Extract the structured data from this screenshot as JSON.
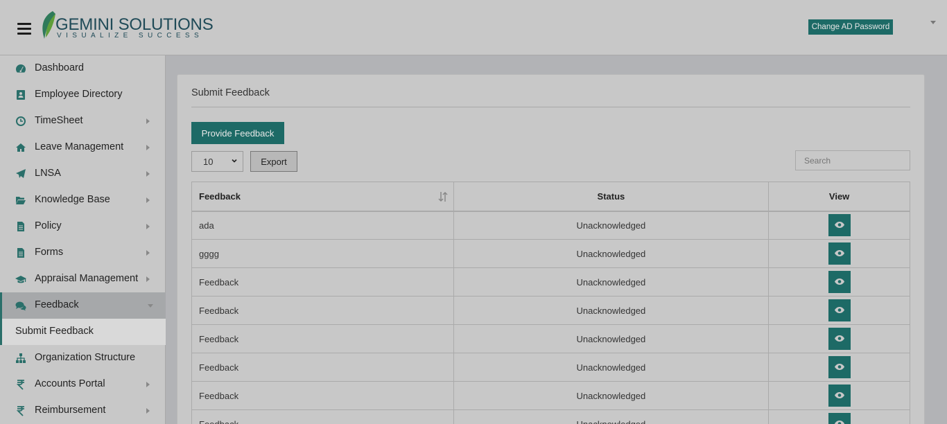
{
  "header": {
    "logo_brand": "GEMINI SOLUTIONS",
    "logo_tagline": "VISUALIZE SUCCESS",
    "change_password_label": "Change AD Password"
  },
  "sidebar": {
    "items": [
      {
        "label": "Dashboard",
        "icon": "dashboard-icon",
        "has_arrow": false
      },
      {
        "label": "Employee Directory",
        "icon": "address-book-icon",
        "has_arrow": false
      },
      {
        "label": "TimeSheet",
        "icon": "clock-icon",
        "has_arrow": true
      },
      {
        "label": "Leave Management",
        "icon": "home-icon",
        "has_arrow": true
      },
      {
        "label": "LNSA",
        "icon": "paper-plane-icon",
        "has_arrow": true
      },
      {
        "label": "Knowledge Base",
        "icon": "folder-open-icon",
        "has_arrow": true
      },
      {
        "label": "Policy",
        "icon": "document-icon",
        "has_arrow": true
      },
      {
        "label": "Forms",
        "icon": "document-icon",
        "has_arrow": true
      },
      {
        "label": "Appraisal Management",
        "icon": "graduation-cap-icon",
        "has_arrow": true
      },
      {
        "label": "Feedback",
        "icon": "comments-icon",
        "has_arrow": true,
        "active": true
      },
      {
        "label": "Submit Feedback",
        "submenu": true
      },
      {
        "label": "Organization Structure",
        "icon": "sitemap-icon",
        "has_arrow": false
      },
      {
        "label": "Accounts Portal",
        "icon": "rupee-icon",
        "has_arrow": true
      },
      {
        "label": "Reimbursement",
        "icon": "rupee-icon",
        "has_arrow": true
      }
    ]
  },
  "main": {
    "title": "Submit Feedback",
    "provide_button": "Provide Feedback",
    "page_size": "10",
    "export_label": "Export",
    "search_placeholder": "Search",
    "columns": [
      "Feedback",
      "Status",
      "View"
    ],
    "rows": [
      {
        "feedback": "ada",
        "status": "Unacknowledged"
      },
      {
        "feedback": "gggg",
        "status": "Unacknowledged"
      },
      {
        "feedback": "Feedback",
        "status": "Unacknowledged"
      },
      {
        "feedback": "Feedback",
        "status": "Unacknowledged"
      },
      {
        "feedback": "Feedback",
        "status": "Unacknowledged"
      },
      {
        "feedback": "Feedback",
        "status": "Unacknowledged"
      },
      {
        "feedback": "Feedback",
        "status": "Unacknowledged"
      },
      {
        "feedback": "Feedback",
        "status": "Unacknowledged"
      }
    ]
  },
  "colors": {
    "accent": "#1d6a66",
    "overlay_bg": "#c8c8c8"
  }
}
